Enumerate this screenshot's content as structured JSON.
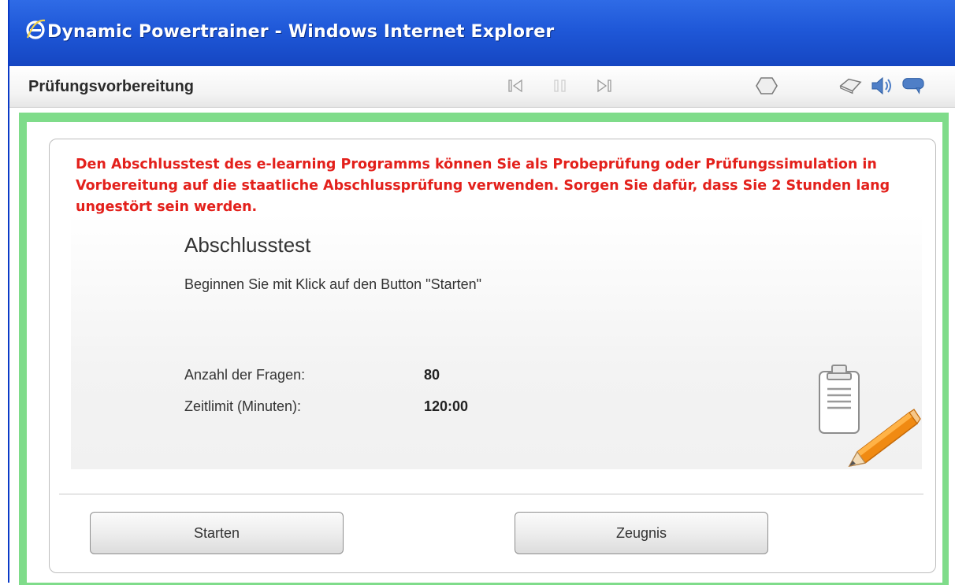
{
  "window": {
    "title": "Dynamic Powertrainer - Windows Internet Explorer",
    "app_icon": "ie-logo-icon"
  },
  "toolbar": {
    "title": "Prüfungsvorbereitung",
    "icons": [
      "skip-back-icon",
      "pause-icon",
      "skip-forward-icon",
      "glossary-icon",
      "dictionary-icon",
      "speaker-icon",
      "comment-icon"
    ]
  },
  "content": {
    "intro": "Den Abschlusstest des e-learning Programms können Sie als Probeprüfung oder Prüfungssimulation in Vorbereitung auf die staatliche Abschlussprüfung verwenden. Sorgen Sie dafür, dass Sie 2 Stunden lang ungestört sein werden.",
    "heading": "Abschlusstest",
    "instruction": "Beginnen Sie mit Klick auf den Button \"Starten\"",
    "questions_label": "Anzahl der Fragen:",
    "questions_value": "80",
    "time_label": "Zeitlimit (Minuten):",
    "time_value": "120:00",
    "illustration_icons": [
      "clipboard-icon",
      "pencil-icon"
    ]
  },
  "buttons": {
    "start": "Starten",
    "certificate": "Zeugnis"
  },
  "colors": {
    "titlebar": "#1f58d8",
    "frame_green": "#7fdc8a",
    "intro_red": "#e3201b"
  }
}
